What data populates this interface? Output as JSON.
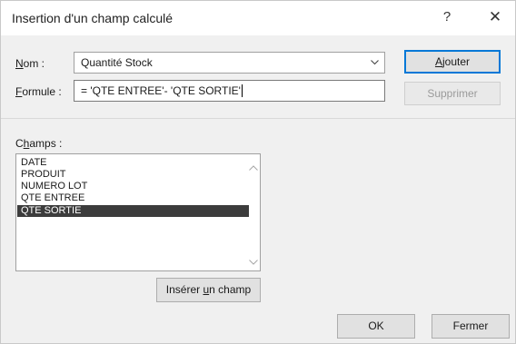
{
  "dialog": {
    "title": "Insertion d'un champ calculé",
    "help_glyph": "?",
    "close_glyph": "✕"
  },
  "nom": {
    "label_accel": "N",
    "label_rest": "om :",
    "value": "Quantité Stock"
  },
  "formule": {
    "label_accel": "F",
    "label_rest": "ormule :",
    "value": "= 'QTE ENTREE'- 'QTE SORTIE'"
  },
  "buttons": {
    "ajouter_accel": "A",
    "ajouter_rest": "jouter",
    "supprimer": "Supprimer",
    "inserer_pre": "Insérer ",
    "inserer_accel": "u",
    "inserer_post": "n champ",
    "ok": "OK",
    "fermer": "Fermer"
  },
  "champs": {
    "label_pre": "C",
    "label_accel": "h",
    "label_rest": "amps :",
    "items": [
      "DATE",
      "PRODUIT",
      "NUMERO LOT",
      "QTE ENTREE",
      "QTE SORTIE"
    ],
    "selected_index": 4
  },
  "icons": {
    "dropdown": "chevron-down-icon",
    "scroll_up": "scroll-up-arrow-icon",
    "scroll_down": "scroll-down-arrow-icon"
  },
  "colors": {
    "focus_border": "#0078d7",
    "selection_bg": "#3c3c3c"
  }
}
